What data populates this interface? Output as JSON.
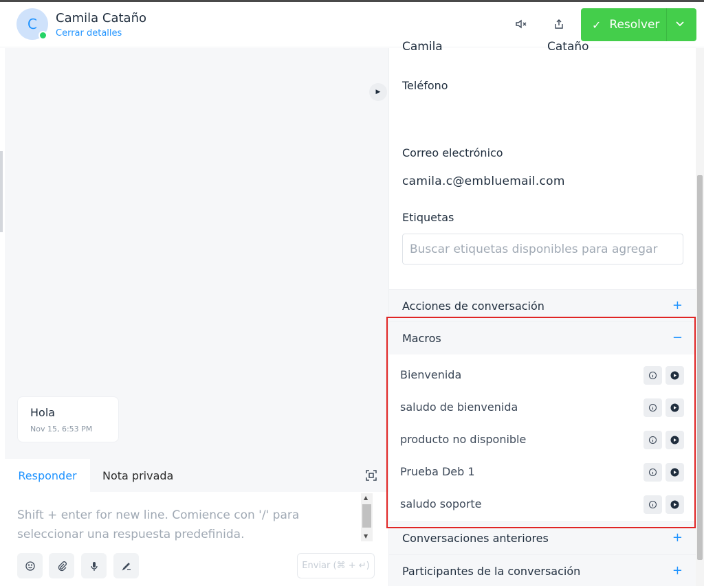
{
  "header": {
    "avatar_initial": "C",
    "contact_name": "Camila Cataño",
    "close_details": "Cerrar detalles",
    "channel_icon": "whatsapp-icon",
    "mute_icon": "speaker-mute-icon",
    "share_icon": "share-icon",
    "resolve_label": "Resolver",
    "resolve_color": "#44ce4b"
  },
  "conversation": {
    "message_text": "Hola",
    "message_time": "Nov 15, 6:53 PM"
  },
  "reply": {
    "tab_reply": "Responder",
    "tab_private": "Nota privada",
    "placeholder": "Shift + enter for new line. Comience con '/' para seleccionar una respuesta predefinida.",
    "send_label": "Enviar (⌘ + ↵)"
  },
  "details": {
    "first_name_cut": "Camila",
    "last_name_cut": "Cataño",
    "phone_label": "Teléfono",
    "email_label": "Correo electrónico",
    "email_value": "camila.c@embluemail.com",
    "tags_label": "Etiquetas",
    "tags_placeholder": "Buscar etiquetas disponibles para agregar"
  },
  "sections": {
    "actions": "Acciones de conversación",
    "macros": "Macros",
    "previous": "Conversaciones anteriores",
    "participants": "Participantes de la conversación"
  },
  "macros": [
    {
      "name": "Bienvenida"
    },
    {
      "name": "saludo de bienvenida"
    },
    {
      "name": "producto no disponible"
    },
    {
      "name": "Prueba Deb 1"
    },
    {
      "name": "saludo soporte"
    }
  ],
  "accent_color": "#1f93ff",
  "highlight_color": "#e02424"
}
